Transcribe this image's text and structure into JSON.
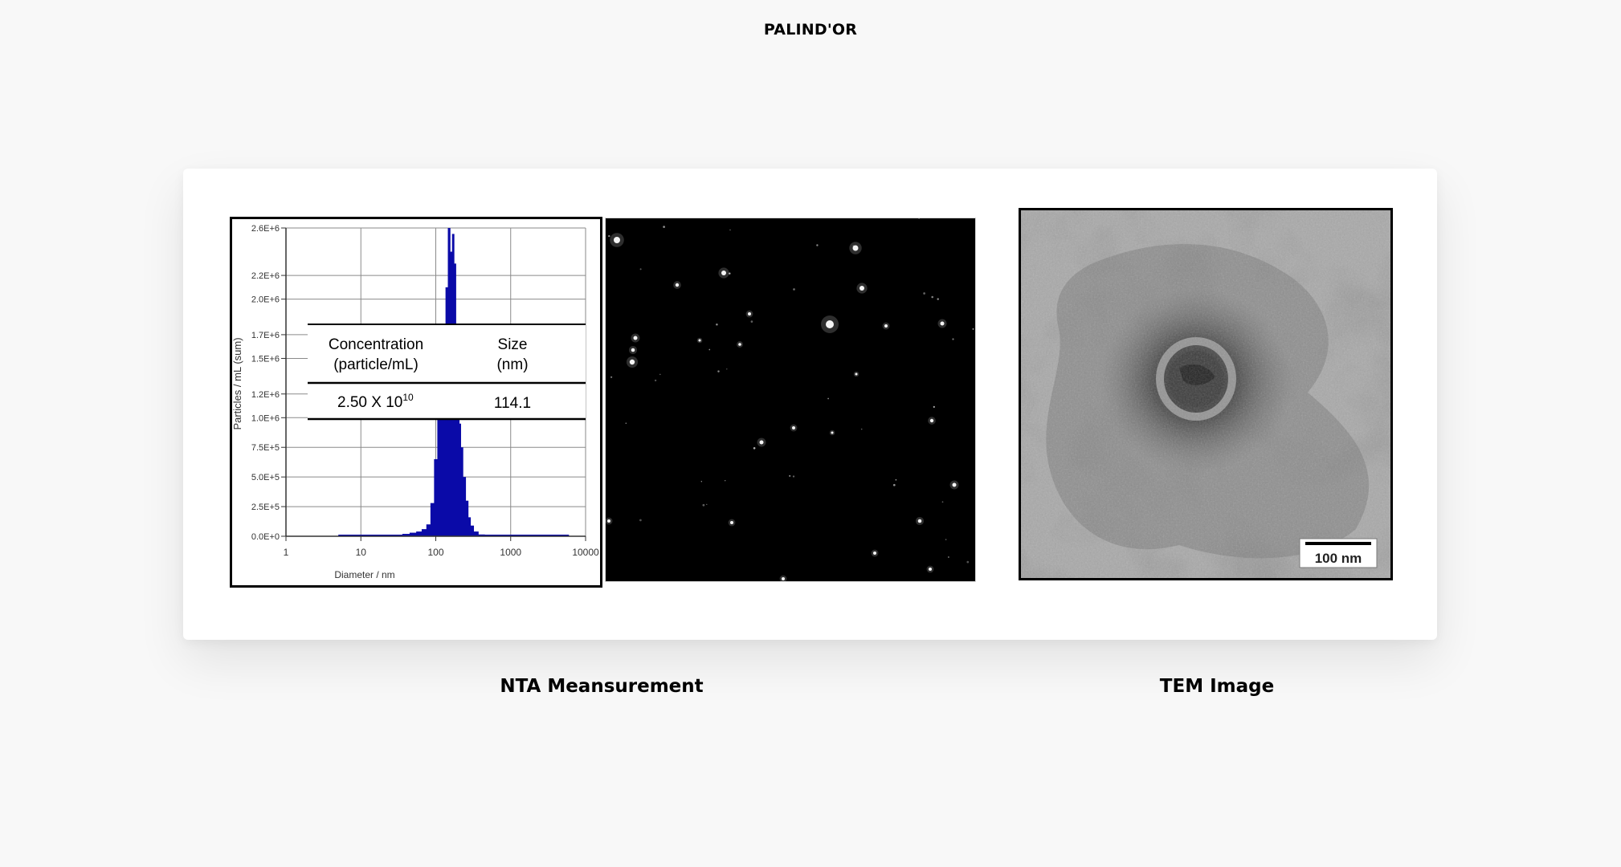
{
  "header": {
    "brand": "PALIND'OR"
  },
  "figures": {
    "nta_caption": "NTA Meansurement",
    "tem_caption": "TEM Image",
    "table": {
      "col1_header_line1": "Concentration",
      "col1_header_line2": "(particle/mL)",
      "col2_header_line1": "Size",
      "col2_header_line2": "(nm)",
      "concentration_base": "2.50 X 10",
      "concentration_exp": "10",
      "size_value": "114.1"
    },
    "scale_bar": "100 nm"
  },
  "chart_data": {
    "type": "bar",
    "xlabel": "Diameter / nm",
    "ylabel": "Particles / mL (sum)",
    "xscale": "log",
    "xlim": [
      1,
      10000
    ],
    "ylim": [
      0,
      2600000
    ],
    "x_tick_labels": [
      "1",
      "10",
      "100",
      "1000",
      "10000"
    ],
    "y_tick_labels": [
      "0.0E+0",
      "2.5E+5",
      "5.0E+5",
      "7.5E+5",
      "1.0E+6",
      "1.2E+6",
      "1.5E+6",
      "1.7E+6",
      "2.0E+6",
      "2.2E+6",
      "2.6E+6"
    ],
    "y_tick_values": [
      0,
      250000,
      500000,
      750000,
      1000000,
      1200000,
      1500000,
      1700000,
      2000000,
      2200000,
      2600000
    ],
    "x": [
      40,
      50,
      60,
      70,
      80,
      90,
      100,
      110,
      120,
      130,
      140,
      150,
      160,
      170,
      180,
      190,
      200,
      210,
      220,
      240,
      260,
      280,
      300,
      340,
      400
    ],
    "values": [
      20000,
      30000,
      40000,
      60000,
      100000,
      280000,
      650000,
      1050000,
      1350000,
      1600000,
      2100000,
      2600000,
      2400000,
      2550000,
      2300000,
      1650000,
      1300000,
      950000,
      750000,
      500000,
      300000,
      160000,
      90000,
      40000,
      15000
    ],
    "colors": {
      "bars": "#0a0aa8",
      "grid": "#8a8a8a"
    }
  },
  "colors": {
    "background": "#f8f8f8",
    "card": "#ffffff"
  }
}
